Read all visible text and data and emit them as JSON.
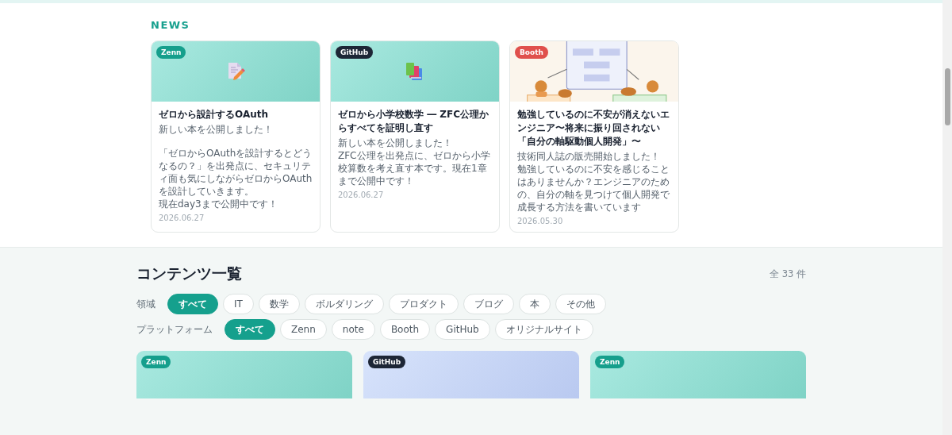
{
  "news": {
    "heading": "NEWS",
    "cards": [
      {
        "badge": {
          "label": "Zenn",
          "kind": "zenn"
        },
        "thumb": {
          "kind": "article"
        },
        "title": "ゼロから設計するOAuth",
        "body": [
          [
            "新しい本を公開しました！"
          ],
          [
            "「ゼロからOAuthを設計するとどうなるの？」を出発点に、セキュリティ面も気にしながらゼロからOAuthを設計していきます。",
            "現在day3まで公開中です！"
          ]
        ],
        "date": "2026.06.27"
      },
      {
        "badge": {
          "label": "GitHub",
          "kind": "github"
        },
        "thumb": {
          "kind": "repository"
        },
        "title": "ゼロから小学校数学 ― ZFC公理からすべてを証明し直す",
        "body": [
          [
            "新しい本を公開しました！",
            "ZFC公理を出発点に、ゼロから小学校算数を考え直す本です。現在1章まで公開中です！"
          ]
        ],
        "date": "2026.06.27"
      },
      {
        "badge": {
          "label": "Booth",
          "kind": "booth"
        },
        "thumb": {
          "kind": "picture"
        },
        "title": "勉強しているのに不安が消えないエンジニア〜将来に振り回されない「自分の軸駆動個人開発」〜",
        "body": [
          [
            "技術同人誌の販売開始しました！",
            "勉強しているのに不安を感じることはありませんか？エンジニアのための、自分の軸を見つけて個人開発で成長する方法を書いています"
          ]
        ],
        "date": "2026.05.30"
      }
    ]
  },
  "contents": {
    "heading": "コンテンツ一覧",
    "count": "全 33 件",
    "filters": [
      {
        "label": "領域",
        "options": [
          {
            "label": "すべて",
            "selected": true
          },
          {
            "label": "IT",
            "selected": false
          },
          {
            "label": "数学",
            "selected": false
          },
          {
            "label": "ボルダリング",
            "selected": false
          },
          {
            "label": "プロダクト",
            "selected": false
          },
          {
            "label": "ブログ",
            "selected": false
          },
          {
            "label": "本",
            "selected": false
          },
          {
            "label": "その他",
            "selected": false
          }
        ]
      },
      {
        "label": "プラットフォーム",
        "options": [
          {
            "label": "すべて",
            "selected": true
          },
          {
            "label": "Zenn",
            "selected": false
          },
          {
            "label": "note",
            "selected": false
          },
          {
            "label": "Booth",
            "selected": false
          },
          {
            "label": "GitHub",
            "selected": false
          },
          {
            "label": "オリジナルサイト",
            "selected": false
          }
        ]
      }
    ],
    "cards": [
      {
        "badge": {
          "label": "Zenn",
          "kind": "zenn"
        },
        "thumb": {
          "kind": "mint"
        }
      },
      {
        "badge": {
          "label": "GitHub",
          "kind": "github"
        },
        "thumb": {
          "kind": "periwinkle"
        }
      },
      {
        "badge": {
          "label": "Zenn",
          "kind": "zenn"
        },
        "thumb": {
          "kind": "mint"
        }
      }
    ]
  }
}
